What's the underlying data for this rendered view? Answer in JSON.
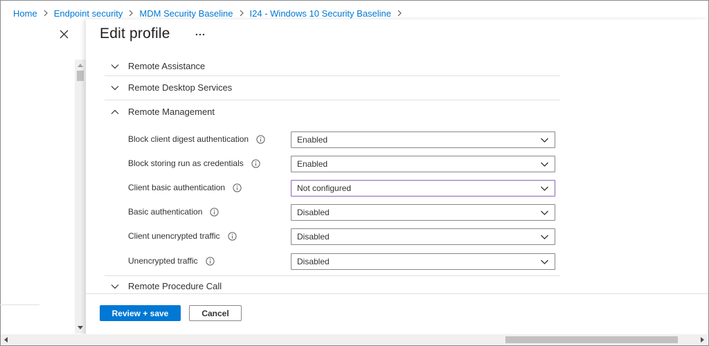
{
  "breadcrumb": {
    "items": [
      "Home",
      "Endpoint security",
      "MDM Security Baseline",
      "I24 - Windows 10 Security Baseline"
    ]
  },
  "panel": {
    "title": "Edit profile"
  },
  "sections": {
    "remote_assistance": "Remote Assistance",
    "remote_desktop": "Remote Desktop Services",
    "remote_management": "Remote Management",
    "remote_procedure": "Remote Procedure Call"
  },
  "settings": [
    {
      "label": "Block client digest authentication",
      "value": "Enabled"
    },
    {
      "label": "Block storing run as credentials",
      "value": "Enabled"
    },
    {
      "label": "Client basic authentication",
      "value": "Not configured"
    },
    {
      "label": "Basic authentication",
      "value": "Disabled"
    },
    {
      "label": "Client unencrypted traffic",
      "value": "Disabled"
    },
    {
      "label": "Unencrypted traffic",
      "value": "Disabled"
    }
  ],
  "footer": {
    "primary_label": "Review + save",
    "secondary_label": "Cancel"
  },
  "colors": {
    "accent": "#0078d4",
    "focus_border": "#8764b8",
    "text": "#323130"
  },
  "icons": {
    "close": "close-icon",
    "more": "more-icon",
    "chevron_down": "chevron-down-icon",
    "chevron_up": "chevron-up-icon",
    "info": "info-icon"
  }
}
